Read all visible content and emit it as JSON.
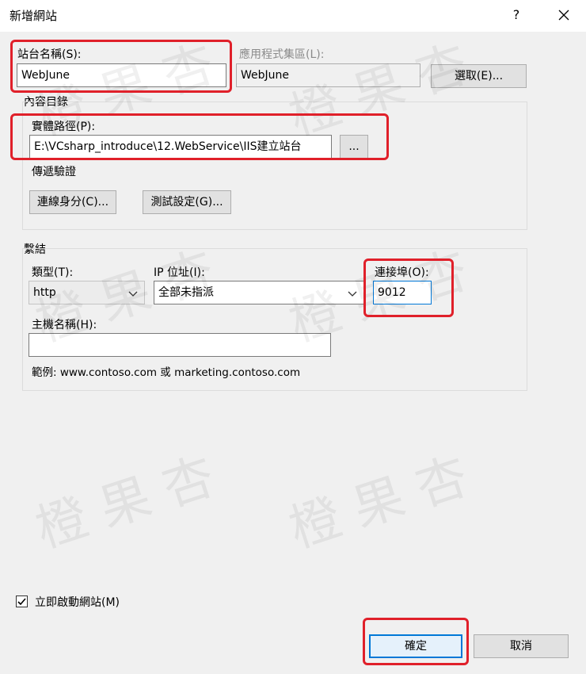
{
  "window": {
    "title": "新增網站",
    "help": "?"
  },
  "site_name": {
    "label": "站台名稱(S):",
    "value": "WebJune"
  },
  "app_pool": {
    "label": "應用程式集區(L):",
    "value": "WebJune",
    "select_button": "選取(E)..."
  },
  "content_dir": {
    "group_label": "內容目錄",
    "physical_path_label": "實體路徑(P):",
    "physical_path_value": "E:\\VCsharp_introduce\\12.WebService\\IIS建立站台",
    "browse_button": "...",
    "pass_through_label": "傳遞驗證",
    "connect_as_button": "連線身分(C)...",
    "test_settings_button": "測試設定(G)..."
  },
  "binding": {
    "group_label": "繫結",
    "type_label": "類型(T):",
    "type_value": "http",
    "ip_label": "IP 位址(I):",
    "ip_value": "全部未指派",
    "port_label": "連接埠(O):",
    "port_value": "9012",
    "host_label": "主機名稱(H):",
    "host_value": "",
    "example": "範例: www.contoso.com 或 marketing.contoso.com"
  },
  "start_immediately": {
    "label": "立即啟動網站(M)",
    "checked": true
  },
  "footer": {
    "ok_button": "確定",
    "cancel_button": "取消"
  },
  "watermark_text": "橙果杏"
}
